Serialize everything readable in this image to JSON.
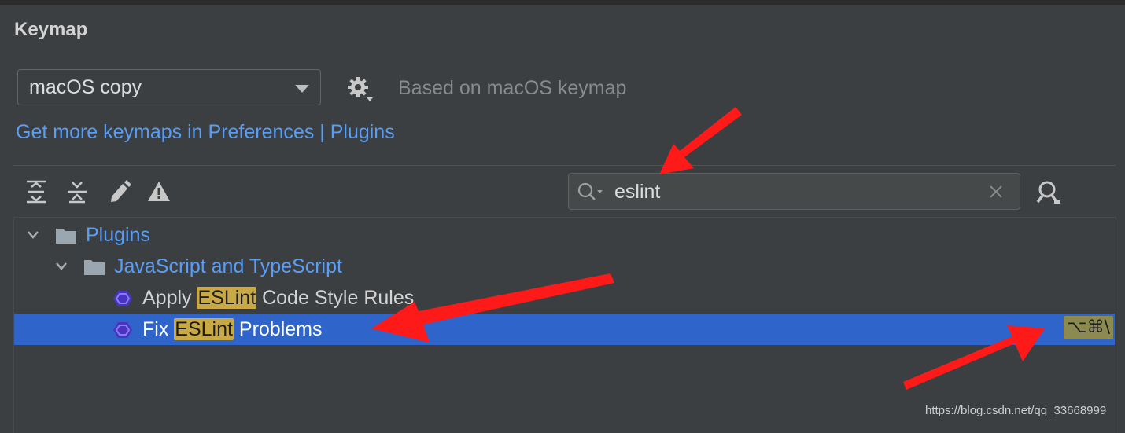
{
  "panel": {
    "title": "Keymap"
  },
  "keymap": {
    "selected": "macOS copy",
    "based_on": "Based on macOS keymap",
    "link_part1": "Get more keymaps in Preferences",
    "link_sep": " | ",
    "link_part2": "Plugins"
  },
  "toolbar": {
    "icons": [
      "expand-all-icon",
      "collapse-all-icon",
      "edit-icon",
      "warning-icon"
    ]
  },
  "search": {
    "value": "eslint"
  },
  "tree": {
    "plugins": "Plugins",
    "javascript": "JavaScript and TypeScript",
    "apply": {
      "before": "Apply ",
      "match": "ESLint",
      "after": " Code Style Rules"
    },
    "fix": {
      "before": "Fix ",
      "match": "ESLint",
      "after": " Problems",
      "shortcut": "⌥⌘\\"
    }
  },
  "watermark": "https://blog.csdn.net/qq_33668999",
  "colors": {
    "background": "#3c3f41",
    "link": "#589df6",
    "selection": "#2f65ca",
    "highlight": "#c9a946",
    "annotation_arrow": "#ff1a1a"
  }
}
